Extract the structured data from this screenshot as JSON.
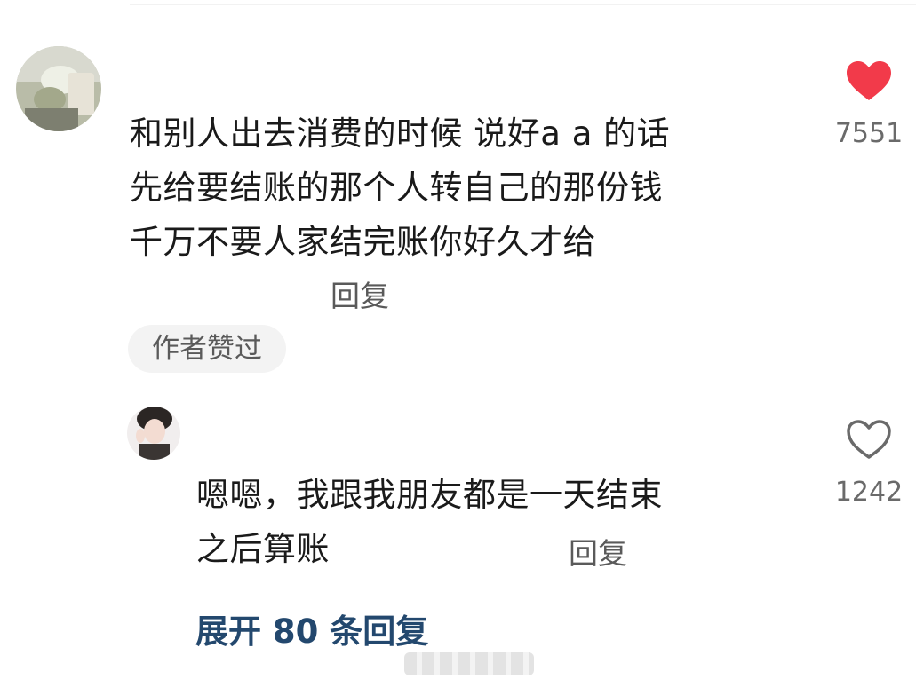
{
  "comment": {
    "text_lines": [
      "和别人出去消费的时候 说好a a 的话",
      "先给要结账的那个人转自己的那份钱",
      "千万不要人家结完账你好久才给"
    ],
    "reply_label": "回复",
    "author_liked_badge": "作者赞过",
    "like_count": "7551",
    "liked": true
  },
  "reply": {
    "text_lines": [
      "嗯嗯，我跟我朋友都是一天结束",
      "之后算账"
    ],
    "reply_label": "回复",
    "like_count": "1242",
    "liked": false
  },
  "expand": {
    "label": "展开 80 条回复"
  },
  "colors": {
    "heart_filled": "#f23a4a",
    "heart_outline": "#6a6a6a",
    "expand_link": "#23486e",
    "text": "#1a1a1a"
  },
  "icons": {
    "main_like": "heart-filled-icon",
    "reply_like": "heart-outline-icon"
  }
}
